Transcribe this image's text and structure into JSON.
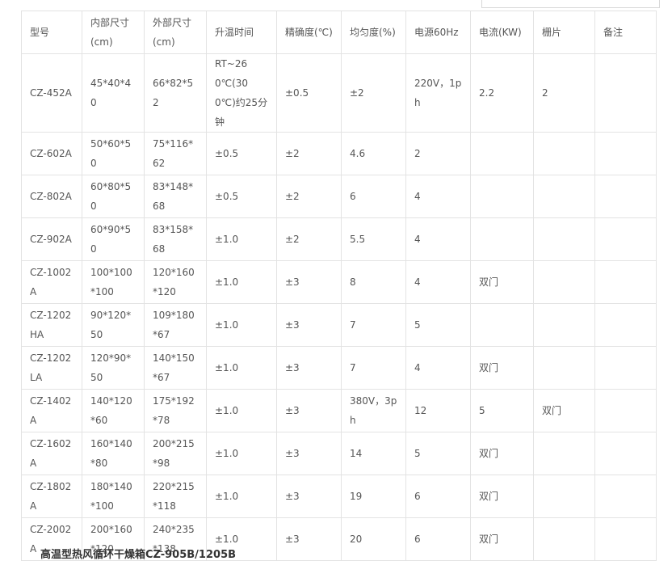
{
  "search_box": {
    "value": ""
  },
  "table": {
    "headers": [
      "型号",
      "内部尺寸(cm)",
      "外部尺寸(cm)",
      "升温时间",
      "精确度(℃)",
      "均匀度(%)",
      "电源60Hz",
      "电流(KW)",
      "栅片",
      "备注"
    ],
    "rows": [
      [
        "CZ-452A",
        "45*40*40",
        "66*82*52",
        "RT~260℃(300℃)约25分钟",
        "±0.5",
        "±2",
        "220V，1ph",
        "2.2",
        "2",
        ""
      ],
      [
        "CZ-602A",
        "50*60*50",
        "75*116*62",
        "±0.5",
        "±2",
        "4.6",
        "2",
        "",
        "",
        ""
      ],
      [
        "CZ-802A",
        "60*80*50",
        "83*148*68",
        "±0.5",
        "±2",
        "6",
        "4",
        "",
        "",
        ""
      ],
      [
        "CZ-902A",
        "60*90*50",
        "83*158*68",
        "±1.0",
        "±2",
        "5.5",
        "4",
        "",
        "",
        ""
      ],
      [
        "CZ-1002A",
        "100*100*100",
        "120*160*120",
        "±1.0",
        "±3",
        "8",
        "4",
        "双门",
        "",
        ""
      ],
      [
        "CZ-1202HA",
        "90*120*50",
        "109*180*67",
        "±1.0",
        "±3",
        "7",
        "5",
        "",
        "",
        ""
      ],
      [
        "CZ-1202LA",
        "120*90*50",
        "140*150*67",
        "±1.0",
        "±3",
        "7",
        "4",
        "双门",
        "",
        ""
      ],
      [
        "CZ-1402A",
        "140*120*60",
        "175*192*78",
        "±1.0",
        "±3",
        "380V，3ph",
        "12",
        "5",
        "双门",
        ""
      ],
      [
        "CZ-1602A",
        "160*140*80",
        "200*215*98",
        "±1.0",
        "±3",
        "14",
        "5",
        "双门",
        "",
        ""
      ],
      [
        "CZ-1802A",
        "180*140*100",
        "220*215*118",
        "±1.0",
        "±3",
        "19",
        "6",
        "双门",
        "",
        ""
      ],
      [
        "CZ-2002A",
        "200*160*120",
        "240*235*138",
        "±1.0",
        "±3",
        "20",
        "6",
        "双门",
        "",
        ""
      ]
    ]
  },
  "footer": {
    "text": "高温型热风循环干燥箱CZ-905B/1205B"
  }
}
